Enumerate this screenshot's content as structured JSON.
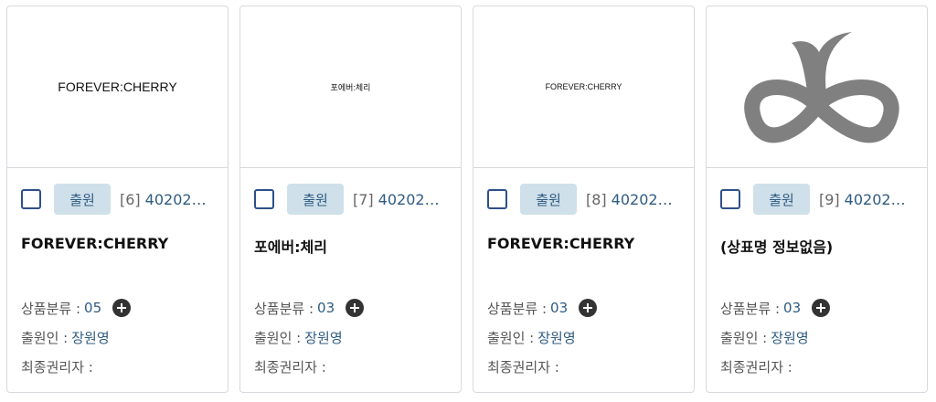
{
  "cards": [
    {
      "thumb_text": "FOREVER:CHERRY",
      "status": "출원",
      "index": "[6]",
      "app_number": "40202…",
      "title": "FOREVER:CHERRY",
      "class_label": "상품분류 :",
      "class_value": "05",
      "applicant_label": "출원인 :",
      "applicant_value": "장원영",
      "final_owner_label": "최종권리자 :"
    },
    {
      "thumb_text": "포에버:체리",
      "status": "출원",
      "index": "[7]",
      "app_number": "40202…",
      "title": "포에버:체리",
      "class_label": "상품분류 :",
      "class_value": "03",
      "applicant_label": "출원인 :",
      "applicant_value": "장원영",
      "final_owner_label": "최종권리자 :"
    },
    {
      "thumb_text": "FOREVER:CHERRY",
      "status": "출원",
      "index": "[8]",
      "app_number": "40202…",
      "title": "FOREVER:CHERRY",
      "class_label": "상품분류 :",
      "class_value": "03",
      "applicant_label": "출원인 :",
      "applicant_value": "장원영",
      "final_owner_label": "최종권리자 :"
    },
    {
      "thumb_icon": "cherry-infinity-logo",
      "status": "출원",
      "index": "[9]",
      "app_number": "40202…",
      "title": "(상표명 정보없음)",
      "class_label": "상품분류 :",
      "class_value": "03",
      "applicant_label": "출원인 :",
      "applicant_value": "장원영",
      "final_owner_label": "최종권리자 :"
    }
  ],
  "colors": {
    "accent": "#2f5b82",
    "badge_bg": "#cfe0ea",
    "logo_gray": "#808080"
  }
}
